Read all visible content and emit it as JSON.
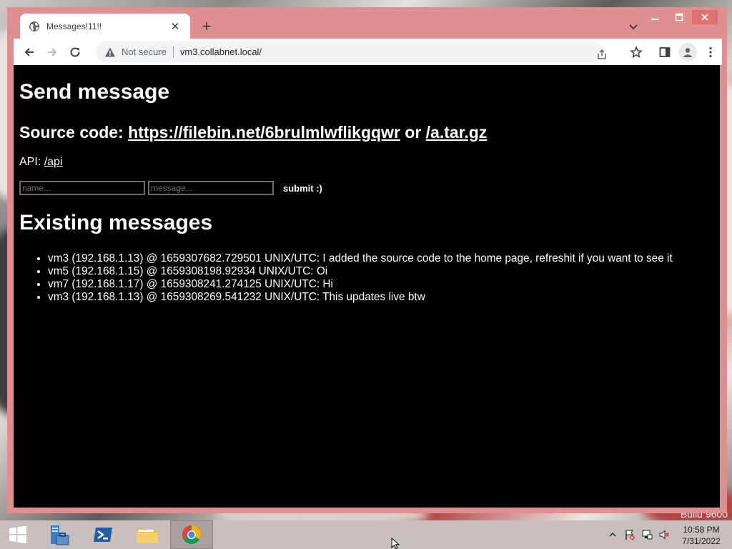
{
  "browser": {
    "tab_title": "Messages!11!!",
    "new_tab_symbol": "+",
    "close_tab_symbol": "✕",
    "not_secure_label": "Not secure",
    "url": "vm3.collabnet.local/"
  },
  "page": {
    "heading_send": "Send message",
    "source_prefix": "Source code:",
    "source_link": "https://filebin.net/6brulmlwflikgqwr",
    "source_or": "or",
    "archive_link": "/a.tar.gz",
    "api_prefix": "API:",
    "api_link": "/api",
    "name_placeholder": "name...",
    "message_placeholder": "message...",
    "submit_label": "submit :)",
    "heading_existing": "Existing messages",
    "messages": [
      "vm3 (192.168.1.13) @ 1659307682.729501 UNIX/UTC: I added the source code to the home page, refreshit if you want to see it",
      "vm5 (192.168.1.15) @ 1659308198.92934 UNIX/UTC: Oi",
      "vm7 (192.168.1.17) @ 1659308241.274125 UNIX/UTC: Hi",
      "vm3 (192.168.1.13) @ 1659308269.541232 UNIX/UTC: This updates live btw"
    ]
  },
  "desktop": {
    "watermark": "Build 9600"
  },
  "taskbar": {
    "time": "10:58 PM",
    "date": "7/31/2022"
  },
  "colors": {
    "window_frame": "#df8f8f",
    "page_background": "#000000",
    "page_text": "#ffffff"
  }
}
